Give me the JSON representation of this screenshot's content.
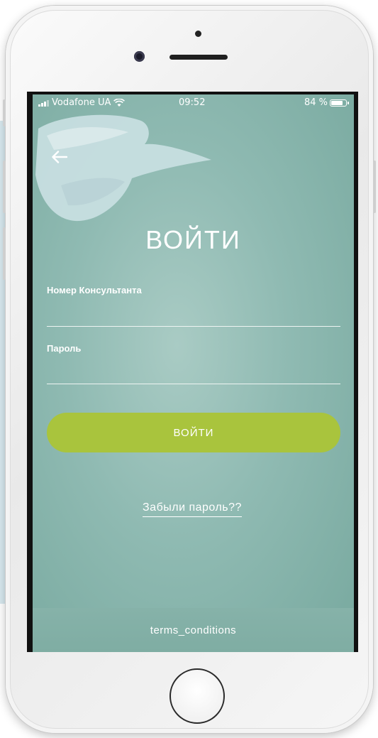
{
  "status_bar": {
    "carrier": "Vodafone UA",
    "time": "09:52",
    "battery_text": "84 %",
    "battery_level": 0.84
  },
  "icons": {
    "back": "arrow-left-icon",
    "signal": "signal-bars-icon",
    "wifi": "wifi-icon",
    "battery": "battery-icon"
  },
  "screen": {
    "title": "ВОЙТИ",
    "consultant_label": "Номер Консультанта",
    "consultant_value": "",
    "password_label": "Пароль",
    "password_value": "",
    "login_button": "ВОЙТИ",
    "forgot_password": "Забыли пароль??",
    "terms": "terms_conditions"
  },
  "colors": {
    "background": "#8fbab2",
    "accent_button": "#a9c43d",
    "text": "#ffffff"
  }
}
